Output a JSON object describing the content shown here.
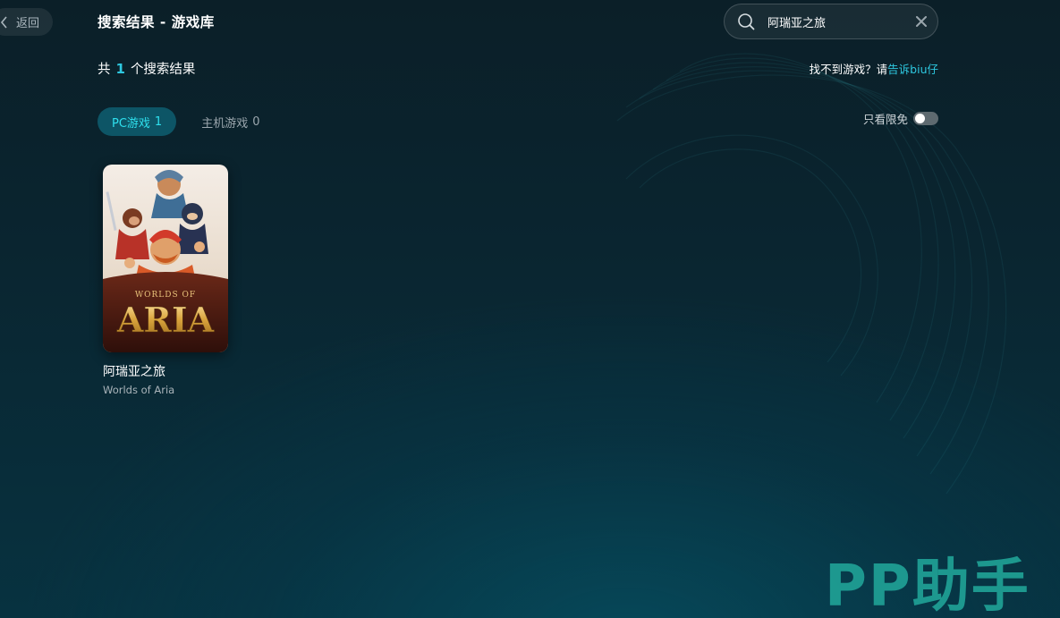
{
  "header": {
    "back_label": "返回",
    "title": "搜索结果 - 游戏库"
  },
  "search": {
    "value": "阿瑞亚之旅",
    "placeholder": ""
  },
  "results": {
    "prefix": "共",
    "count": "1",
    "suffix": "个搜索结果"
  },
  "help": {
    "text": "找不到游戏？请",
    "link": "告诉biu仔"
  },
  "tabs": [
    {
      "label": "PC游戏",
      "count": "1",
      "active": true
    },
    {
      "label": "主机游戏",
      "count": "0",
      "active": false
    }
  ],
  "filter": {
    "free_only_label": "只看限免",
    "free_only_on": false
  },
  "games": [
    {
      "name": "阿瑞亚之旅",
      "subtitle": "Worlds of Aria",
      "cover_text_top": "WORLDS OF",
      "cover_text_main": "ARIA"
    }
  ],
  "brand": {
    "logo": "PP助手"
  },
  "colors": {
    "accent": "#2ec8e0",
    "tab_active_bg": "#0d5566",
    "brand": "#1f9e93"
  }
}
